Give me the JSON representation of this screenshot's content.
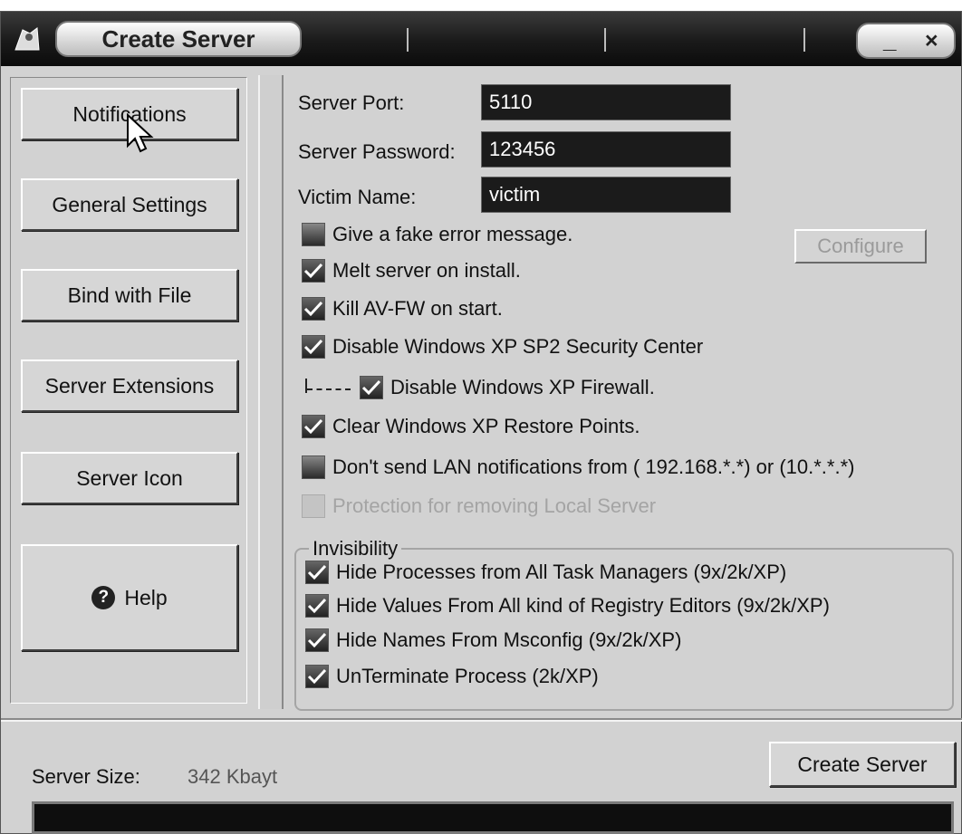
{
  "window": {
    "title": "Create Server",
    "minimize_glyph": "_",
    "close_glyph": "×"
  },
  "nav": {
    "notifications": "Notifications",
    "general_settings": "General Settings",
    "bind_with_file": "Bind with File",
    "server_extensions": "Server Extensions",
    "server_icon": "Server Icon",
    "help": "Help",
    "help_icon_glyph": "?"
  },
  "fields": {
    "port_label": "Server Port:",
    "port_value": "5110",
    "password_label": "Server Password:",
    "password_value": "123456",
    "victim_label": "Victim Name:",
    "victim_value": "victim"
  },
  "options": [
    {
      "label": "Give a fake error message.",
      "checked": false
    },
    {
      "label": "Melt server on install.",
      "checked": true
    },
    {
      "label": "Kill AV-FW on start.",
      "checked": true
    },
    {
      "label": "Disable Windows XP SP2 Security Center",
      "checked": true
    },
    {
      "label": "Disable Windows XP Firewall.",
      "checked": true
    },
    {
      "label": "Clear Windows XP Restore Points.",
      "checked": true
    },
    {
      "label": "Don't send LAN notifications from ( 192.168.*.*) or (10.*.*.*)",
      "checked": false
    },
    {
      "label": "Protection for removing Local Server",
      "checked": false,
      "disabled": true
    }
  ],
  "configure_label": "Configure",
  "invisibility": {
    "legend": "Invisibility",
    "items": [
      {
        "label": "Hide Processes from All Task Managers  (9x/2k/XP)",
        "checked": true
      },
      {
        "label": "Hide Values From All kind of Registry Editors (9x/2k/XP)",
        "checked": true
      },
      {
        "label": "Hide Names From Msconfig  (9x/2k/XP)",
        "checked": true
      },
      {
        "label": "UnTerminate Process (2k/XP)",
        "checked": true
      }
    ]
  },
  "footer": {
    "size_label": "Server Size:",
    "size_value": "342 Kbayt",
    "create_label": "Create Server",
    "progress_fraction": 1.0
  },
  "icons": {
    "app": "app-icon",
    "check": "check-icon",
    "help": "help-icon",
    "cursor": "mouse-cursor-icon"
  }
}
